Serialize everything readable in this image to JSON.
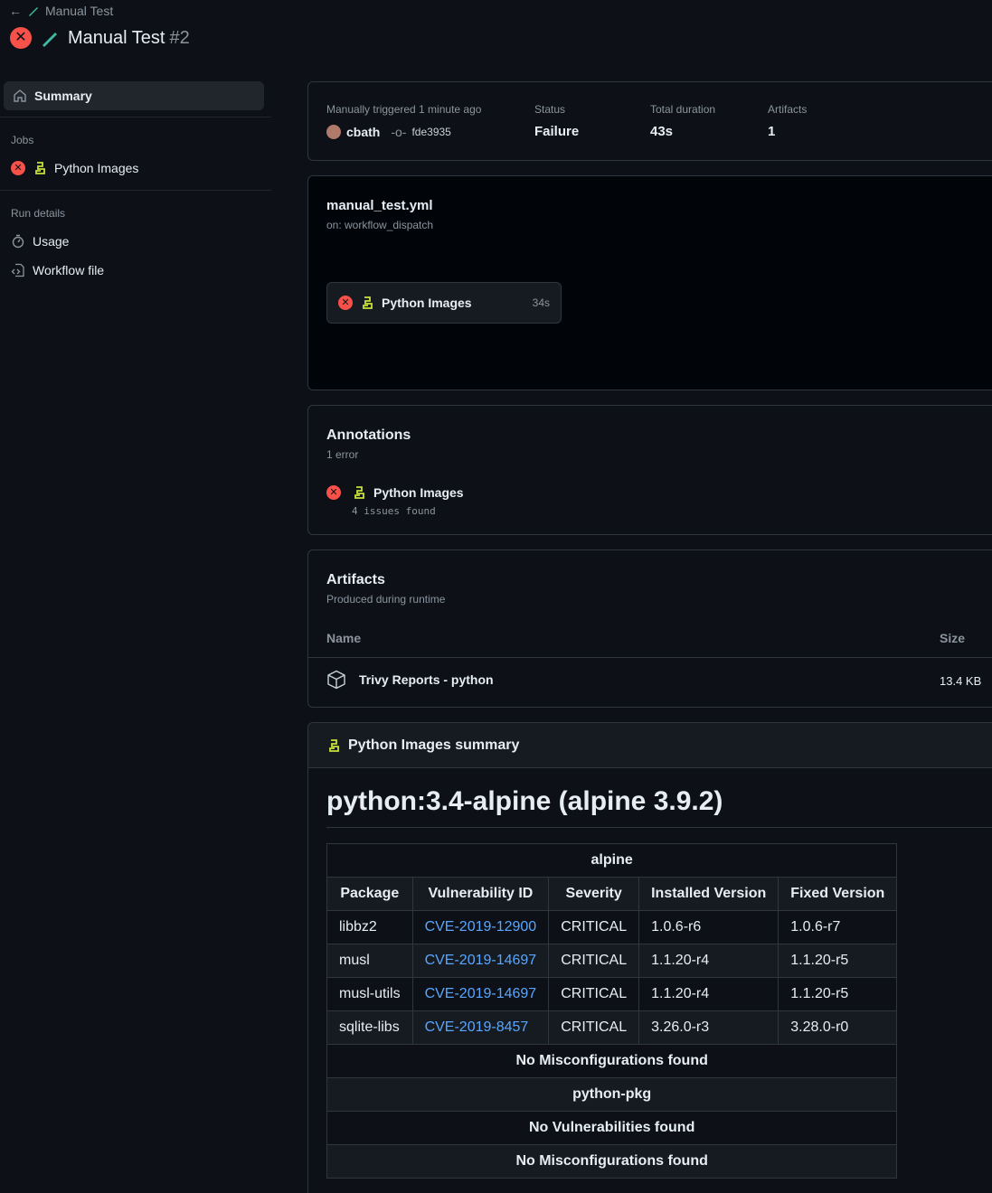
{
  "header": {
    "back_label": "Manual Test",
    "title": "Manual Test",
    "run_number": "#2"
  },
  "sidebar": {
    "summary": "Summary",
    "jobs_heading": "Jobs",
    "job": "Python Images",
    "run_details_heading": "Run details",
    "usage": "Usage",
    "workflow_file": "Workflow file"
  },
  "run_info": {
    "trigger_label": "Manually triggered 1 minute ago",
    "user": "cbath",
    "commit": "fde3935",
    "status_label": "Status",
    "status_value": "Failure",
    "duration_label": "Total duration",
    "duration_value": "43s",
    "artifacts_label": "Artifacts",
    "artifacts_value": "1"
  },
  "workflow": {
    "file": "manual_test.yml",
    "trigger": "on: workflow_dispatch",
    "job_name": "Python Images",
    "job_duration": "34s"
  },
  "annotations": {
    "title": "Annotations",
    "count": "1 error",
    "job": "Python Images",
    "detail": "4 issues found"
  },
  "artifacts": {
    "title": "Artifacts",
    "subtitle": "Produced during runtime",
    "col_name": "Name",
    "col_size": "Size",
    "item_name": "Trivy Reports - python",
    "item_size": "13.4 KB"
  },
  "summary": {
    "title": "Python Images summary",
    "image_heading": "python:3.4-alpine (alpine 3.9.2)",
    "section1": "alpine",
    "headers": [
      "Package",
      "Vulnerability ID",
      "Severity",
      "Installed Version",
      "Fixed Version"
    ],
    "rows": [
      [
        "libbz2",
        "CVE-2019-12900",
        "CRITICAL",
        "1.0.6-r6",
        "1.0.6-r7"
      ],
      [
        "musl",
        "CVE-2019-14697",
        "CRITICAL",
        "1.1.20-r4",
        "1.1.20-r5"
      ],
      [
        "musl-utils",
        "CVE-2019-14697",
        "CRITICAL",
        "1.1.20-r4",
        "1.1.20-r5"
      ],
      [
        "sqlite-libs",
        "CVE-2019-8457",
        "CRITICAL",
        "3.26.0-r3",
        "3.28.0-r0"
      ]
    ],
    "no_misconfig_1": "No Misconfigurations found",
    "section2": "python-pkg",
    "no_vuln": "No Vulnerabilities found",
    "no_misconfig_2": "No Misconfigurations found"
  },
  "colors": {
    "failure": "#f85149",
    "link": "#58a6ff",
    "python": "#c8e13a"
  }
}
